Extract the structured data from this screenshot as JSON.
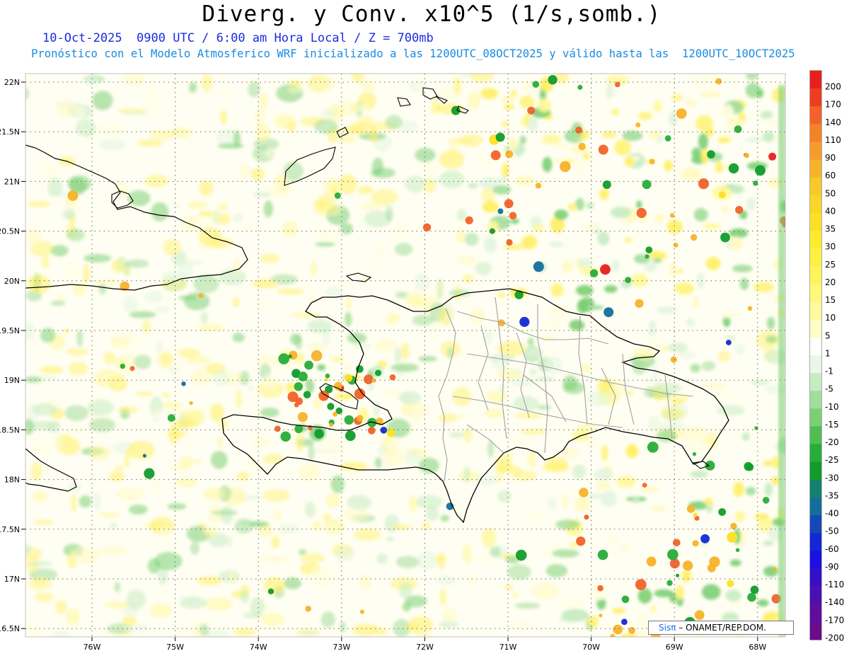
{
  "header": {
    "title": "Diverg. y Conv. x10^5 (1/s,somb.)",
    "subtitle_date": "10-Oct-2025  0900 UTC / 6:00 am Hora Local / Z = 700mb",
    "subtitle_model": "Pronóstico con el Modelo Atmosferico WRF inicializado a las 1200UTC_08OCT2025 y válido hasta las  1200UTC_10OCT2025"
  },
  "map": {
    "lat_labels": [
      "22N",
      "21.5N",
      "21N",
      "20.5N",
      "20N",
      "19.5N",
      "19N",
      "18.5N",
      "18N",
      "17.5N",
      "17N",
      "16.5N"
    ],
    "lon_labels": [
      "76W",
      "75W",
      "74W",
      "73W",
      "72W",
      "71W",
      "70W",
      "69W",
      "68W"
    ],
    "colors": {
      "land_line": "#000000",
      "province_line": "#a0a0a0",
      "grid_line": "#666666"
    }
  },
  "colorbar": {
    "labels": [
      "200",
      "170",
      "140",
      "110",
      "90",
      "60",
      "50",
      "40",
      "35",
      "30",
      "25",
      "20",
      "15",
      "10",
      "5",
      "1",
      "-1",
      "-5",
      "-10",
      "-15",
      "-20",
      "-25",
      "-30",
      "-35",
      "-40",
      "-50",
      "-60",
      "-90",
      "-110",
      "-140",
      "-170",
      "-200"
    ],
    "colors": [
      "#e8201c",
      "#ef3d20",
      "#f2622a",
      "#f48228",
      "#f59d2a",
      "#f7b32a",
      "#f8c92a",
      "#fad52a",
      "#fde025",
      "#feeb2c",
      "#fef141",
      "#fff55a",
      "#fff879",
      "#fffa9e",
      "#fffcc6",
      "#ffffff",
      "#eaf7e7",
      "#c7ecc3",
      "#a2dd9b",
      "#7bcf74",
      "#4fbe51",
      "#27ad38",
      "#119c2c",
      "#12826e",
      "#146e9c",
      "#1448b8",
      "#1228d4",
      "#1c10e2",
      "#3410c8",
      "#4c10b2",
      "#5e0e9e",
      "#6b0c8a"
    ]
  },
  "credit": {
    "sis": "Sisπ",
    "org": "– ONAMET/REP.DOM."
  }
}
